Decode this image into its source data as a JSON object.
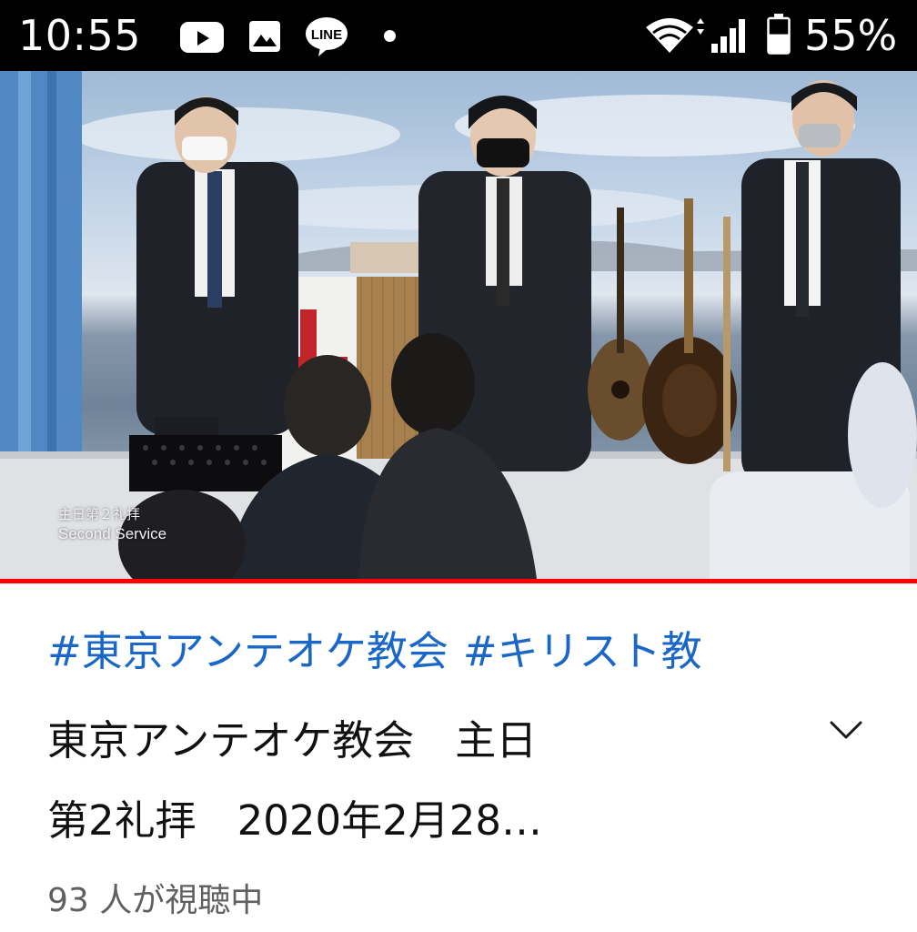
{
  "status_bar": {
    "time": "10:55",
    "battery_percent": "55%",
    "battery_level": 0.55,
    "icons": [
      "youtube-icon",
      "gallery-icon",
      "line-app-icon",
      "notification-dot-icon",
      "wifi-icon",
      "cell-signal-icon",
      "battery-icon"
    ],
    "line_badge_text": "LINE"
  },
  "video": {
    "overlay_jp": "主日第２礼拝",
    "overlay_en": "Second Service",
    "progress_fraction": 1.0,
    "progress_color": "#ff0000"
  },
  "metadata": {
    "hashtags": [
      "#東京アンテオケ教会",
      "#キリスト教"
    ],
    "title_line1": "東京アンテオケ教会　主日",
    "title_line2": "第2礼拝　2020年2月28…",
    "viewers": "93 人が視聴中",
    "hashtag_color": "#1a67c8"
  }
}
